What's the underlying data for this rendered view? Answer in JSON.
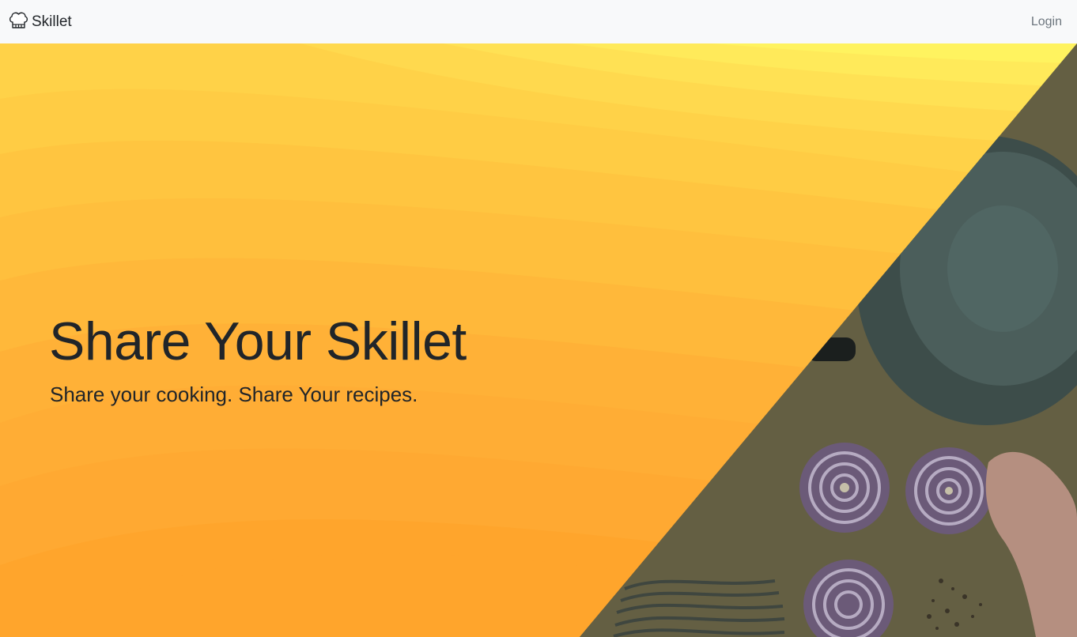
{
  "navbar": {
    "brand_label": "Skillet",
    "brand_icon": "chef-hat-icon",
    "login_label": "Login"
  },
  "hero": {
    "title": "Share Your Skillet",
    "subtitle": "Share your cooking. Share Your recipes."
  },
  "colors": {
    "navbar_bg": "#f8f9fa",
    "text_dark": "#212529",
    "nav_link": "#6c757d",
    "hero_yellow_light": "#fff35f",
    "hero_orange_dark": "#ffa52c",
    "photo_tint": "#5a5745"
  }
}
